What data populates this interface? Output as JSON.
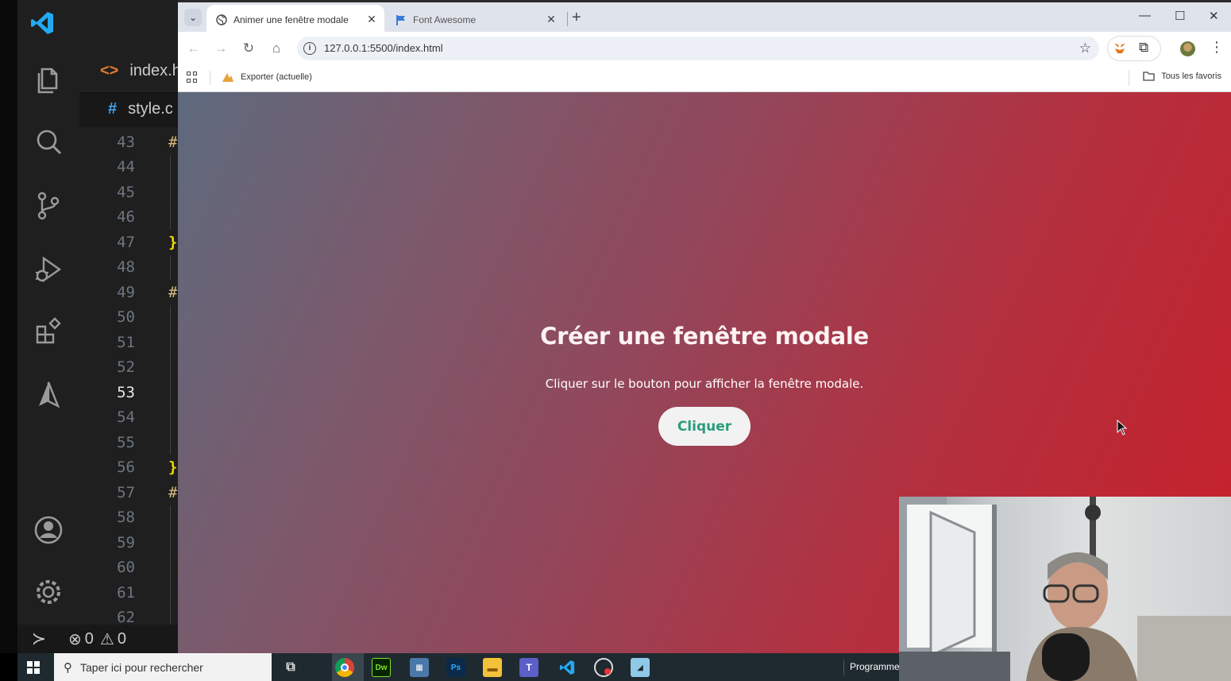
{
  "vscode": {
    "tabs": [
      {
        "icon": "<>",
        "label": "index.h"
      },
      {
        "icon": "#",
        "label": "style.c"
      }
    ],
    "lines": [
      {
        "num": "43",
        "code": "#"
      },
      {
        "num": "44",
        "code": ""
      },
      {
        "num": "45",
        "code": ""
      },
      {
        "num": "46",
        "code": ""
      },
      {
        "num": "47",
        "code": "}"
      },
      {
        "num": "48",
        "code": ""
      },
      {
        "num": "49",
        "code": "#"
      },
      {
        "num": "50",
        "code": ""
      },
      {
        "num": "51",
        "code": ""
      },
      {
        "num": "52",
        "code": ""
      },
      {
        "num": "53",
        "code": ""
      },
      {
        "num": "54",
        "code": ""
      },
      {
        "num": "55",
        "code": ""
      },
      {
        "num": "56",
        "code": "}"
      },
      {
        "num": "57",
        "code": "#"
      },
      {
        "num": "58",
        "code": ""
      },
      {
        "num": "59",
        "code": ""
      },
      {
        "num": "60",
        "code": ""
      },
      {
        "num": "61",
        "code": ""
      },
      {
        "num": "62",
        "code": ""
      }
    ],
    "active_line": "53",
    "status": {
      "errors": "0",
      "warnings": "0"
    }
  },
  "browser": {
    "tabs": [
      {
        "title": "Animer une fenêtre modale",
        "active": true
      },
      {
        "title": "Font Awesome",
        "active": false
      }
    ],
    "new_tab": "+",
    "url": "127.0.0.1:5500/index.html",
    "bookmarks": {
      "item": "Exporter (actuelle)",
      "all_favorites": "Tous les favoris"
    }
  },
  "page": {
    "heading": "Créer une fenêtre modale",
    "text": "Cliquer sur le bouton pour afficher la fenêtre modale.",
    "button": "Cliquer",
    "colors": {
      "gradient_start": "#5e6a7e",
      "gradient_end": "#c8202a",
      "button_text": "#2a9d7a"
    }
  },
  "taskbar": {
    "search_placeholder": "Taper ici pour rechercher",
    "apps": [
      "chrome",
      "Dw",
      "calculator",
      "Ps",
      "file-explorer",
      "teams",
      "vscode",
      "obs",
      "notepad"
    ],
    "overflow_label": "Programme"
  }
}
